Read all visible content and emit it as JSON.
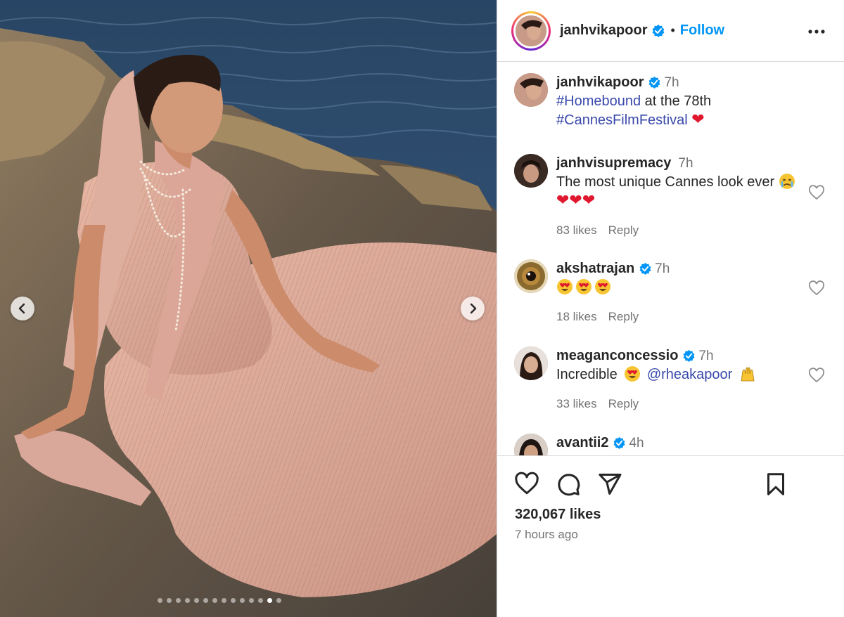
{
  "post": {
    "author": "janhvikapoor",
    "follow_label": "Follow",
    "separator": "•",
    "likes": "320,067 likes",
    "time_ago": "7 hours ago",
    "carousel": {
      "count": 14,
      "active_index": 12
    }
  },
  "caption": {
    "username": "janhvikapoor",
    "time": "7h",
    "hashtag1": "#Homebound",
    "text_mid": " at the 78th",
    "hashtag2": "#CannesFilmFestival"
  },
  "comments": [
    {
      "username": "janhvisupremacy",
      "time": "7h",
      "text": "The most unique Cannes look ever",
      "likes": "83 likes",
      "reply": "Reply",
      "verified": false
    },
    {
      "username": "akshatrajan",
      "time": "7h",
      "text": "",
      "likes": "18 likes",
      "reply": "Reply",
      "verified": true
    },
    {
      "username": "meaganconcessio",
      "time": "7h",
      "text": "Incredible",
      "mention": "@rheakapoor",
      "likes": "33 likes",
      "reply": "Reply",
      "verified": true
    },
    {
      "username": "avantii2",
      "time": "4h",
      "verified": true
    }
  ],
  "icons": [
    "verified-badge-icon",
    "more-options-icon",
    "like-heart-icon",
    "comment-icon",
    "share-icon",
    "save-bookmark-icon",
    "chevron-left-icon",
    "chevron-right-icon"
  ],
  "colors": {
    "link": "#0095f6",
    "hashtag": "#3949ab",
    "muted": "#737373",
    "verified": "#0095f6"
  }
}
